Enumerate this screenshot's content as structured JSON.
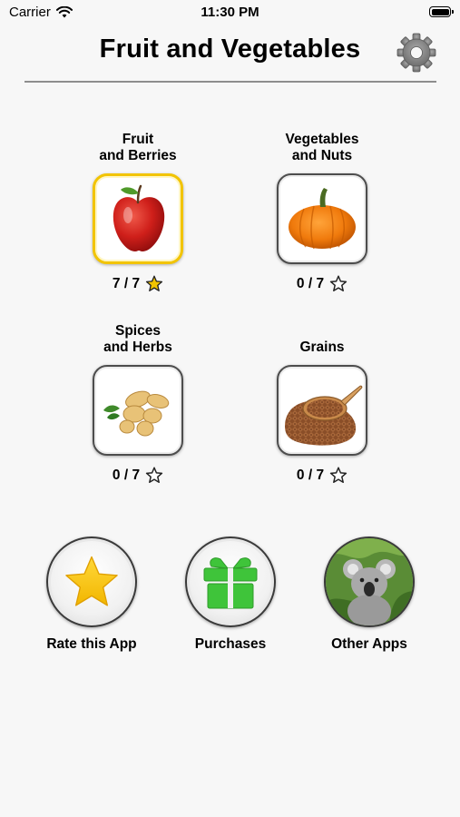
{
  "status_bar": {
    "carrier": "Carrier",
    "time": "11:30 PM"
  },
  "header": {
    "title": "Fruit and Vegetables",
    "settings_icon": "gear-icon"
  },
  "categories": [
    {
      "label": "Fruit\nand Berries",
      "score": "7 / 7",
      "completed": true,
      "icon": "apple-icon",
      "star_color": "#f2c400"
    },
    {
      "label": "Vegetables\nand Nuts",
      "score": "0 / 7",
      "completed": false,
      "icon": "pumpkin-icon"
    },
    {
      "label": "Spices\nand Herbs",
      "score": "0 / 7",
      "completed": false,
      "icon": "ginger-icon"
    },
    {
      "label": "Grains",
      "score": "0 / 7",
      "completed": false,
      "icon": "buckwheat-icon"
    }
  ],
  "actions": [
    {
      "label": "Rate this App",
      "icon": "star-icon"
    },
    {
      "label": "Purchases",
      "icon": "gift-icon"
    },
    {
      "label": "Other Apps",
      "icon": "koala-icon"
    }
  ],
  "colors": {
    "accent_yellow": "#f2c400",
    "gift_green": "#3fc43a",
    "divider": "#8e8e8e"
  }
}
